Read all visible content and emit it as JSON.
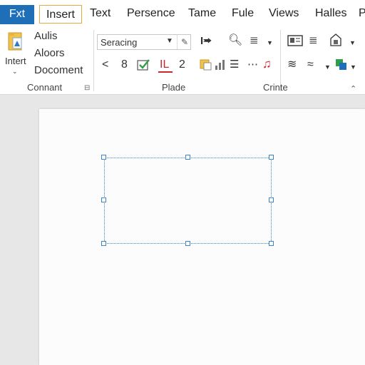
{
  "tabs": {
    "file": "Fxt",
    "insert": "Insert",
    "text": "Text",
    "persence": "Persence",
    "tame": "Tame",
    "fule": "Fule",
    "views": "Views",
    "halles": "Halles",
    "p": "P"
  },
  "ribbon": {
    "group1": {
      "big_button_label": "Intert",
      "items": [
        "Aulis",
        "Aloors",
        "Docoment"
      ],
      "label": "Connant",
      "launcher_icon": "dialog-launcher-icon"
    },
    "group2": {
      "dropdown_value": "Seracing",
      "row2": {
        "left": "<",
        "num1": "8",
        "underline": "IL",
        "num2": "2"
      },
      "label": "Plade"
    },
    "group3": {
      "label": "Crinte"
    }
  },
  "colors": {
    "file_tab": "#1e6fb8",
    "active_tab_border": "#e7a93b",
    "selection": "#3a86c8",
    "accent_red": "#c8282d",
    "accent_green": "#2f9e48"
  }
}
